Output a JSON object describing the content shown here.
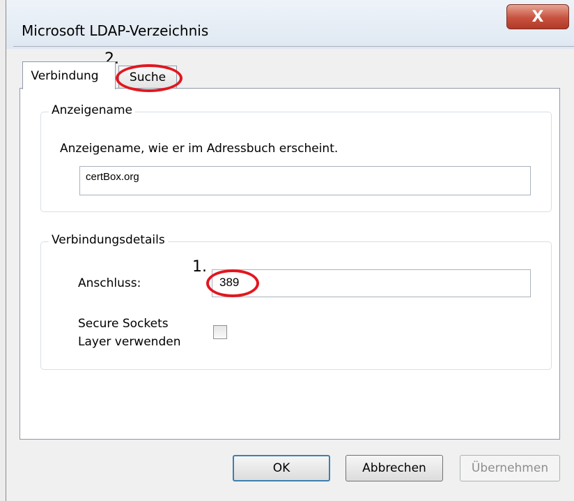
{
  "window": {
    "title": "Microsoft LDAP-Verzeichnis",
    "close_symbol": "X"
  },
  "tabs": [
    {
      "label": "Verbindung",
      "active": true
    },
    {
      "label": "Suche",
      "active": false
    }
  ],
  "display_name_group": {
    "legend": "Anzeigename",
    "description": "Anzeigename, wie er im Adressbuch erscheint.",
    "value": "certBox.org"
  },
  "connection_group": {
    "legend": "Verbindungsdetails",
    "port_label": "Anschluss:",
    "port_value": "389",
    "ssl_label_line1": "Secure Sockets",
    "ssl_label_line2": "Layer verwenden",
    "ssl_checked": false
  },
  "buttons": {
    "ok": "OK",
    "cancel": "Abbrechen",
    "apply": "Übernehmen"
  },
  "annotations": {
    "step1": "1.",
    "step2": "2."
  },
  "colors": {
    "annotation": "#e2161f",
    "close_button": "#c7523f"
  }
}
